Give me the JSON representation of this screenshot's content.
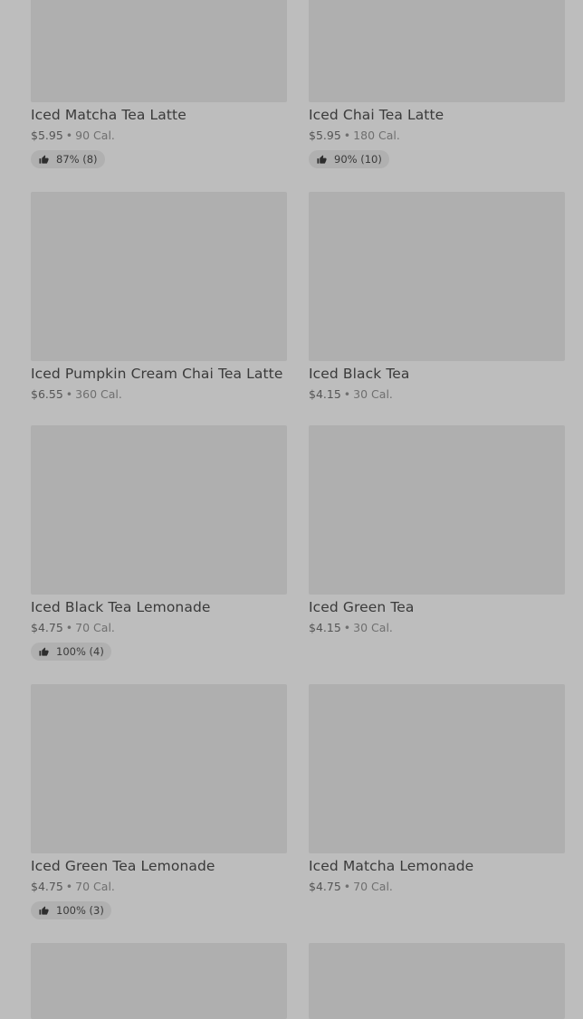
{
  "items": [
    {
      "name": "Iced Matcha Tea Latte",
      "price": "$5.95",
      "calories": "90 Cal.",
      "rating": "87% (8)"
    },
    {
      "name": "Iced Chai Tea Latte",
      "price": "$5.95",
      "calories": "180 Cal.",
      "rating": "90% (10)"
    },
    {
      "name": "Iced Pumpkin Cream Chai Tea Latte",
      "price": "$6.55",
      "calories": "360 Cal."
    },
    {
      "name": "Iced Black Tea",
      "price": "$4.15",
      "calories": "30 Cal."
    },
    {
      "name": "Iced Black Tea Lemonade",
      "price": "$4.75",
      "calories": "70 Cal.",
      "rating": "100% (4)"
    },
    {
      "name": "Iced Green Tea",
      "price": "$4.15",
      "calories": "30 Cal."
    },
    {
      "name": "Iced Green Tea Lemonade",
      "price": "$4.75",
      "calories": "70 Cal.",
      "rating": "100% (3)"
    },
    {
      "name": "Iced Matcha Lemonade",
      "price": "$4.75",
      "calories": "70 Cal."
    }
  ],
  "separator": "•",
  "icons": {
    "rating": "thumbs-up-icon"
  }
}
